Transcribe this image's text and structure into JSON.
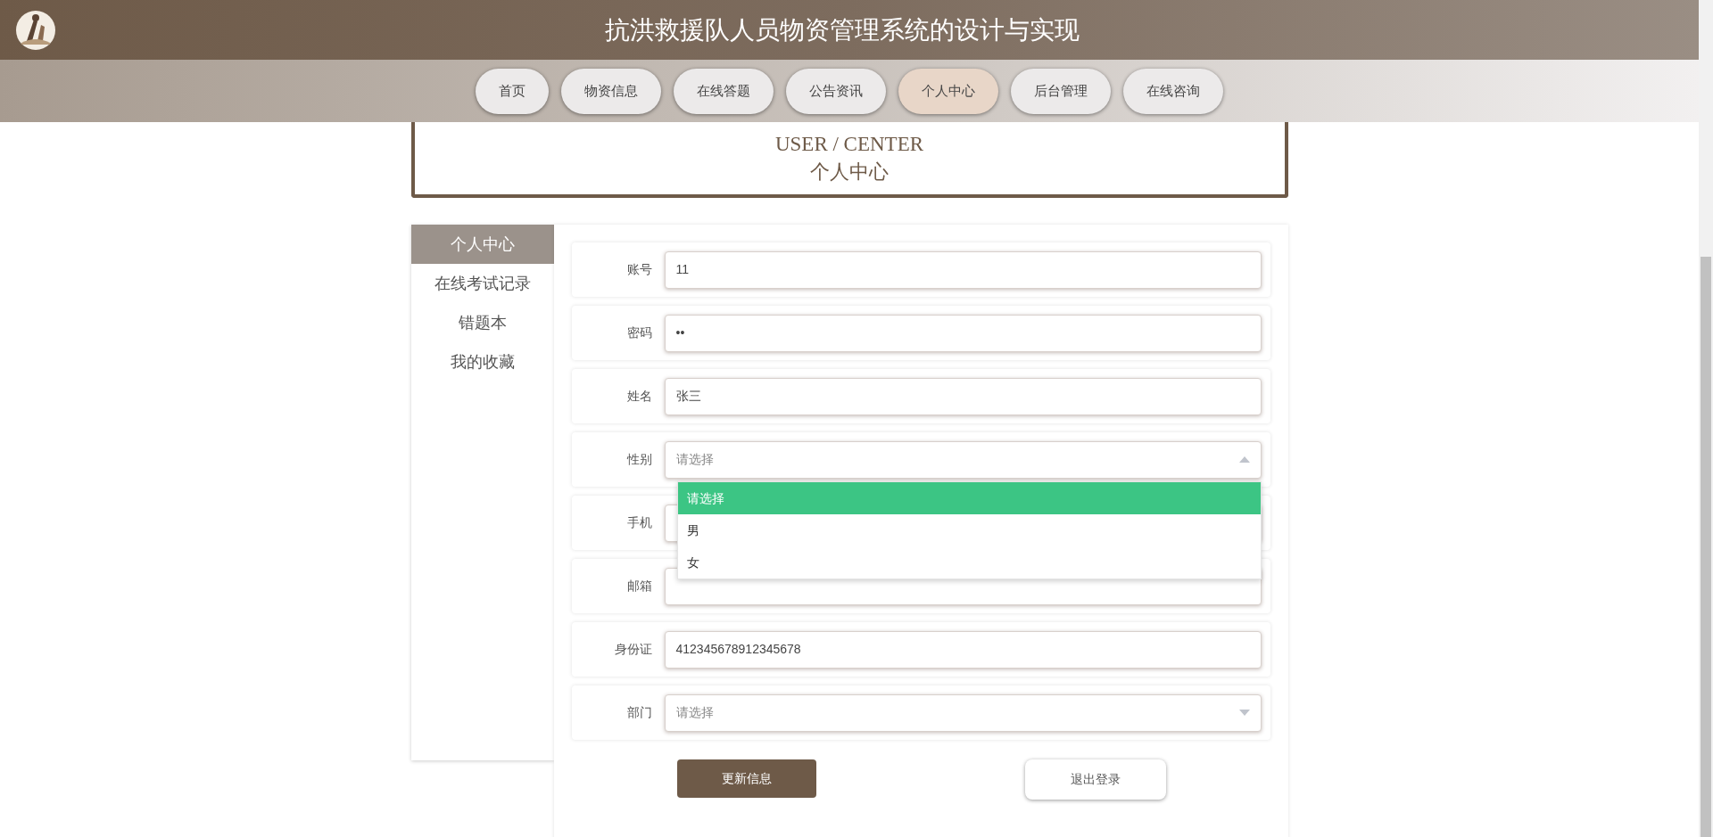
{
  "header": {
    "title": "抗洪救援队人员物资管理系统的设计与实现"
  },
  "nav": [
    {
      "label": "首页",
      "selected": false
    },
    {
      "label": "物资信息",
      "selected": false
    },
    {
      "label": "在线答题",
      "selected": false
    },
    {
      "label": "公告资讯",
      "selected": false
    },
    {
      "label": "个人中心",
      "selected": true
    },
    {
      "label": "后台管理",
      "selected": false
    },
    {
      "label": "在线咨询",
      "selected": false
    }
  ],
  "banner": {
    "title_en": "USER / CENTER",
    "title_cn": "个人中心"
  },
  "sidebar": [
    {
      "label": "个人中心",
      "selected": true
    },
    {
      "label": "在线考试记录",
      "selected": false
    },
    {
      "label": "错题本",
      "selected": false
    },
    {
      "label": "我的收藏",
      "selected": false
    }
  ],
  "form": [
    {
      "label": "账号",
      "kind": "text",
      "value": "11"
    },
    {
      "label": "密码",
      "kind": "text",
      "value": "••"
    },
    {
      "label": "姓名",
      "kind": "text",
      "value": "张三"
    },
    {
      "label": "性别",
      "kind": "select",
      "placeholder": "请选择",
      "expanded": true,
      "options": [
        {
          "label": "请选择",
          "selected": true
        },
        {
          "label": "男",
          "selected": false
        },
        {
          "label": "女",
          "selected": false
        }
      ]
    },
    {
      "label": "手机",
      "kind": "text"
    },
    {
      "label": "邮箱",
      "kind": "text"
    },
    {
      "label": "身份证",
      "kind": "text",
      "value": "412345678912345678"
    },
    {
      "label": "部门",
      "kind": "select",
      "placeholder": "请选择",
      "expanded": false
    }
  ],
  "buttons": [
    {
      "label": "更新信息",
      "kind": "primary"
    },
    {
      "label": "退出登录",
      "kind": "secondary"
    }
  ]
}
